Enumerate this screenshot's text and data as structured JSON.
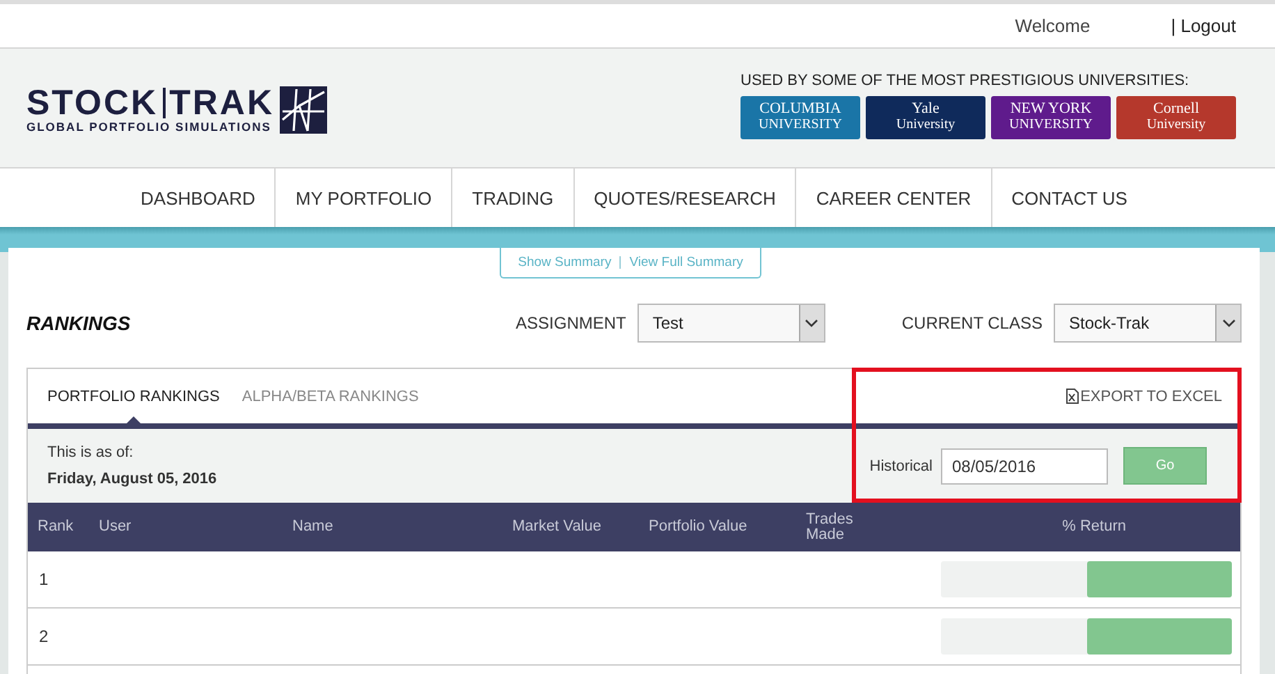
{
  "topbar": {
    "welcome": "Welcome",
    "logout": "| Logout"
  },
  "logo": {
    "name_left": "STOCK",
    "name_right": "TRAK",
    "tagline": "GLOBAL PORTFOLIO SIMULATIONS"
  },
  "universities": {
    "heading": "USED BY SOME OF THE MOST PRESTIGIOUS UNIVERSITIES:",
    "items": [
      {
        "line1": "COLUMBIA",
        "line2": "UNIVERSITY",
        "color": "#1a75a7"
      },
      {
        "line1": "Yale",
        "line2": "University",
        "color": "#0f2a5b"
      },
      {
        "line1": "NEW YORK",
        "line2": "UNIVERSITY",
        "color": "#5f1b8c"
      },
      {
        "line1": "Cornell",
        "line2": "University",
        "color": "#b5382c"
      }
    ]
  },
  "nav": [
    "DASHBOARD",
    "MY PORTFOLIO",
    "TRADING",
    "QUOTES/RESEARCH",
    "CAREER CENTER",
    "CONTACT US"
  ],
  "summary_links": [
    "Show Summary",
    "View Full Summary"
  ],
  "title": "RANKINGS",
  "assignment": {
    "label": "ASSIGNMENT",
    "value": "Test"
  },
  "current_class": {
    "label": "CURRENT CLASS",
    "value": "Stock-Trak"
  },
  "tabs": [
    {
      "label": "PORTFOLIO RANKINGS",
      "selected": true
    },
    {
      "label": "ALPHA/BETA RANKINGS",
      "selected": false
    }
  ],
  "export": "EXPORT TO EXCEL",
  "highlighted": true,
  "as_of": {
    "label": "This is as of:",
    "date": "Friday, August 05, 2016"
  },
  "historical": {
    "label": "Historical",
    "value": "08/05/2016",
    "button": "Go"
  },
  "table": {
    "columns": [
      "Rank",
      "User",
      "Name",
      "Market Value",
      "Portfolio Value",
      "Trades Made",
      "% Return"
    ],
    "rows": [
      {
        "rank": "1",
        "level": 0.5
      },
      {
        "rank": "2",
        "level": 0.5
      }
    ]
  }
}
